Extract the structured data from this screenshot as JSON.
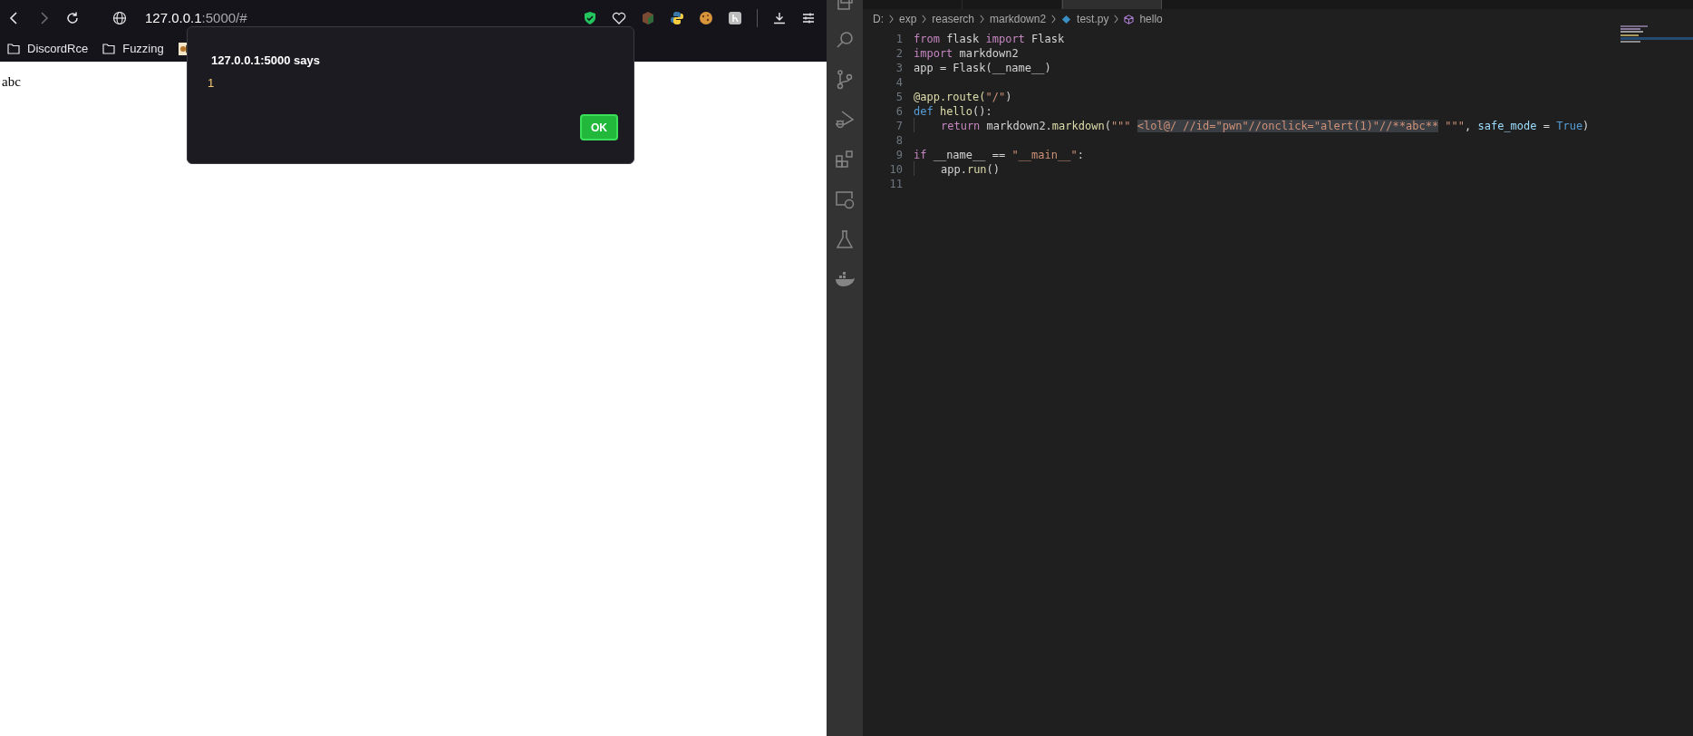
{
  "browser": {
    "url_host": "127.0.0.1",
    "url_rest": ":5000/#",
    "bookmarks": [
      {
        "label": "DiscordRce",
        "kind": "folder"
      },
      {
        "label": "Fuzzing",
        "kind": "folder"
      },
      {
        "kind": "favicon"
      }
    ],
    "page_text": "abc",
    "dialog": {
      "title": "127.0.0.1:5000 says",
      "message": "1",
      "button": "OK"
    }
  },
  "editor": {
    "tabs": [
      {
        "selected": false
      },
      {
        "selected": false
      },
      {
        "selected": true
      }
    ],
    "breadcrumbs": [
      {
        "label": "D:",
        "kind": "plain"
      },
      {
        "label": "exp",
        "kind": "plain"
      },
      {
        "label": "reaserch",
        "kind": "plain"
      },
      {
        "label": "markdown2",
        "kind": "plain"
      },
      {
        "label": "test.py",
        "kind": "python"
      },
      {
        "label": "hello",
        "kind": "symbol"
      }
    ],
    "lines": [
      {
        "number": "1",
        "tokens": [
          {
            "text": "from",
            "kind": "keyword"
          },
          {
            "text": " flask ",
            "kind": "plain"
          },
          {
            "text": "import",
            "kind": "keyword"
          },
          {
            "text": " Flask",
            "kind": "plain"
          }
        ]
      },
      {
        "number": "2",
        "tokens": [
          {
            "text": "import",
            "kind": "keyword"
          },
          {
            "text": " markdown2",
            "kind": "plain"
          }
        ]
      },
      {
        "number": "3",
        "tokens": [
          {
            "text": "app = Flask(__name__)",
            "kind": "plain"
          }
        ]
      },
      {
        "number": "4"
      },
      {
        "number": "5",
        "tokens": [
          {
            "text": "@app.route(",
            "kind": "decorator"
          },
          {
            "text": "\"/\"",
            "kind": "string"
          },
          {
            "text": ")",
            "kind": "plain"
          }
        ]
      },
      {
        "number": "6",
        "tokens": [
          {
            "text": "def",
            "kind": "storage"
          },
          {
            "text": " hello",
            "kind": "function"
          },
          {
            "text": "():",
            "kind": "plain"
          }
        ]
      },
      {
        "number": "7",
        "indent": true,
        "tokens": [
          {
            "text": "return",
            "kind": "keyword"
          },
          {
            "text": " markdown2.",
            "kind": "plain"
          },
          {
            "text": "markdown",
            "kind": "function"
          },
          {
            "text": "(",
            "kind": "plain"
          },
          {
            "text": "\"\"\" ",
            "kind": "string"
          },
          {
            "text": "<lol@/ //id=\"pwn\"//onclick=\"alert(1)\"//**abc**",
            "kind": "highlight"
          },
          {
            "text": " \"\"\"",
            "kind": "string"
          },
          {
            "text": ", ",
            "kind": "plain"
          },
          {
            "text": "safe_mode",
            "kind": "variable"
          },
          {
            "text": " = ",
            "kind": "plain"
          },
          {
            "text": "True",
            "kind": "storage"
          },
          {
            "text": ")",
            "kind": "plain"
          }
        ]
      },
      {
        "number": "8"
      },
      {
        "number": "9",
        "tokens": [
          {
            "text": "if",
            "kind": "keyword"
          },
          {
            "text": " __name__ == ",
            "kind": "plain"
          },
          {
            "text": "\"__main__\"",
            "kind": "string"
          },
          {
            "text": ":",
            "kind": "plain"
          }
        ]
      },
      {
        "number": "10",
        "indent": true,
        "tokens": [
          {
            "text": "app.",
            "kind": "plain"
          },
          {
            "text": "run",
            "kind": "function"
          },
          {
            "text": "()",
            "kind": "plain"
          }
        ]
      },
      {
        "number": "11"
      }
    ]
  }
}
